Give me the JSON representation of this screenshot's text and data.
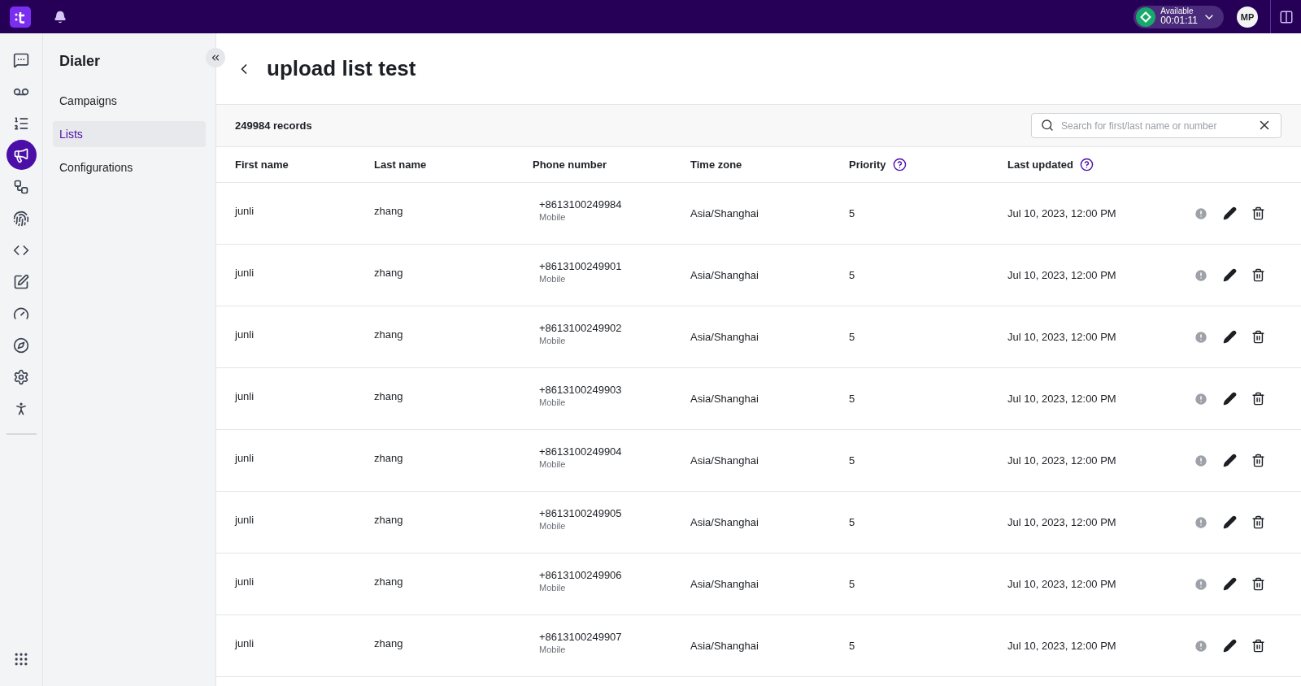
{
  "top_bar": {
    "status": {
      "label": "Available",
      "timer": "00:01:11"
    },
    "avatar": "MP"
  },
  "rail": [
    {
      "selected": false
    },
    {
      "selected": false
    },
    {
      "selected": false
    },
    {
      "selected": true
    },
    {
      "selected": false
    },
    {
      "selected": false
    },
    {
      "selected": false
    },
    {
      "selected": false
    },
    {
      "selected": false
    },
    {
      "selected": false
    },
    {
      "selected": false
    },
    {
      "selected": false
    }
  ],
  "sidebar": {
    "title": "Dialer",
    "items": [
      {
        "label": "Campaigns",
        "selected": false
      },
      {
        "label": "Lists",
        "selected": true
      },
      {
        "label": "Configurations",
        "selected": false
      }
    ]
  },
  "page": {
    "title": "upload list test",
    "records": "249984 records",
    "search": {
      "placeholder": "Search for first/last name or number"
    }
  },
  "table": {
    "columns": [
      {
        "label": "First name",
        "help": false
      },
      {
        "label": "Last name",
        "help": false
      },
      {
        "label": "Phone number",
        "help": false
      },
      {
        "label": "Time zone",
        "help": false
      },
      {
        "label": "Priority",
        "help": true
      },
      {
        "label": "Last updated",
        "help": true
      }
    ],
    "rows": [
      {
        "first": "junli",
        "last": "zhang",
        "phone": "+8613100249984",
        "phone_type": "Mobile",
        "zone": "Asia/Shanghai",
        "priority": "5",
        "updated": "Jul 10, 2023, 12:00 PM"
      },
      {
        "first": "junli",
        "last": "zhang",
        "phone": "+8613100249901",
        "phone_type": "Mobile",
        "zone": "Asia/Shanghai",
        "priority": "5",
        "updated": "Jul 10, 2023, 12:00 PM"
      },
      {
        "first": "junli",
        "last": "zhang",
        "phone": "+8613100249902",
        "phone_type": "Mobile",
        "zone": "Asia/Shanghai",
        "priority": "5",
        "updated": "Jul 10, 2023, 12:00 PM"
      },
      {
        "first": "junli",
        "last": "zhang",
        "phone": "+8613100249903",
        "phone_type": "Mobile",
        "zone": "Asia/Shanghai",
        "priority": "5",
        "updated": "Jul 10, 2023, 12:00 PM"
      },
      {
        "first": "junli",
        "last": "zhang",
        "phone": "+8613100249904",
        "phone_type": "Mobile",
        "zone": "Asia/Shanghai",
        "priority": "5",
        "updated": "Jul 10, 2023, 12:00 PM"
      },
      {
        "first": "junli",
        "last": "zhang",
        "phone": "+8613100249905",
        "phone_type": "Mobile",
        "zone": "Asia/Shanghai",
        "priority": "5",
        "updated": "Jul 10, 2023, 12:00 PM"
      },
      {
        "first": "junli",
        "last": "zhang",
        "phone": "+8613100249906",
        "phone_type": "Mobile",
        "zone": "Asia/Shanghai",
        "priority": "5",
        "updated": "Jul 10, 2023, 12:00 PM"
      },
      {
        "first": "junli",
        "last": "zhang",
        "phone": "+8613100249907",
        "phone_type": "Mobile",
        "zone": "Asia/Shanghai",
        "priority": "5",
        "updated": "Jul 10, 2023, 12:00 PM"
      }
    ]
  }
}
